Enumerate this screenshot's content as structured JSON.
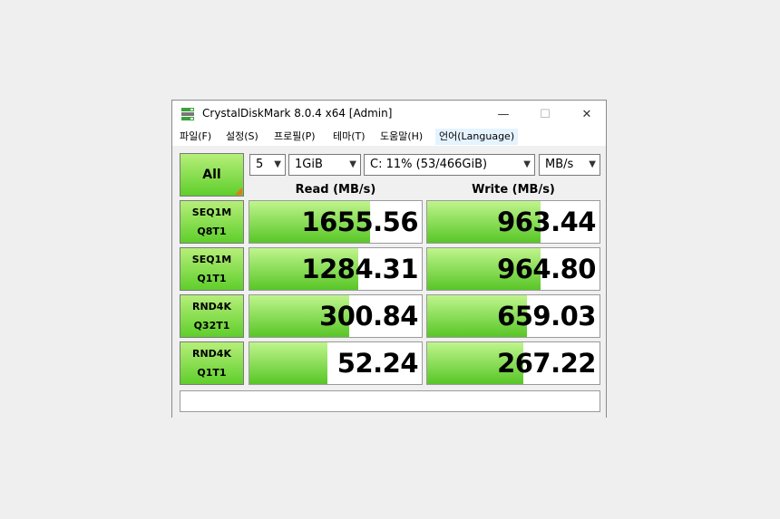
{
  "window": {
    "title": "CrystalDiskMark 8.0.4 x64 [Admin]",
    "minimize": "—",
    "maximize": "☐",
    "close": "✕"
  },
  "menu": [
    {
      "label": "파일(F)"
    },
    {
      "label": "설정(S)"
    },
    {
      "label": "프로필(P)"
    },
    {
      "label": "테마(T)"
    },
    {
      "label": "도움말(H)"
    },
    {
      "label": "언어(Language)"
    }
  ],
  "controls": {
    "all_label": "All",
    "count": "5",
    "size": "1GiB",
    "drive": "C: 11% (53/466GiB)",
    "unit": "MB/s"
  },
  "headers": {
    "read": "Read (MB/s)",
    "write": "Write (MB/s)"
  },
  "tests": [
    {
      "line1": "SEQ1M",
      "line2": "Q8T1",
      "read": "1655.56",
      "write": "963.44",
      "read_fill": 0.7,
      "write_fill": 0.66
    },
    {
      "line1": "SEQ1M",
      "line2": "Q1T1",
      "read": "1284.31",
      "write": "964.80",
      "read_fill": 0.63,
      "write_fill": 0.66
    },
    {
      "line1": "RND4K",
      "line2": "Q32T1",
      "read": "300.84",
      "write": "659.03",
      "read_fill": 0.58,
      "write_fill": 0.58
    },
    {
      "line1": "RND4K",
      "line2": "Q1T1",
      "read": "52.24",
      "write": "267.22",
      "read_fill": 0.45,
      "write_fill": 0.56
    }
  ],
  "comment": "",
  "colors": {
    "accent_green": "#5fce2b",
    "corner_orange": "#e57a14"
  }
}
